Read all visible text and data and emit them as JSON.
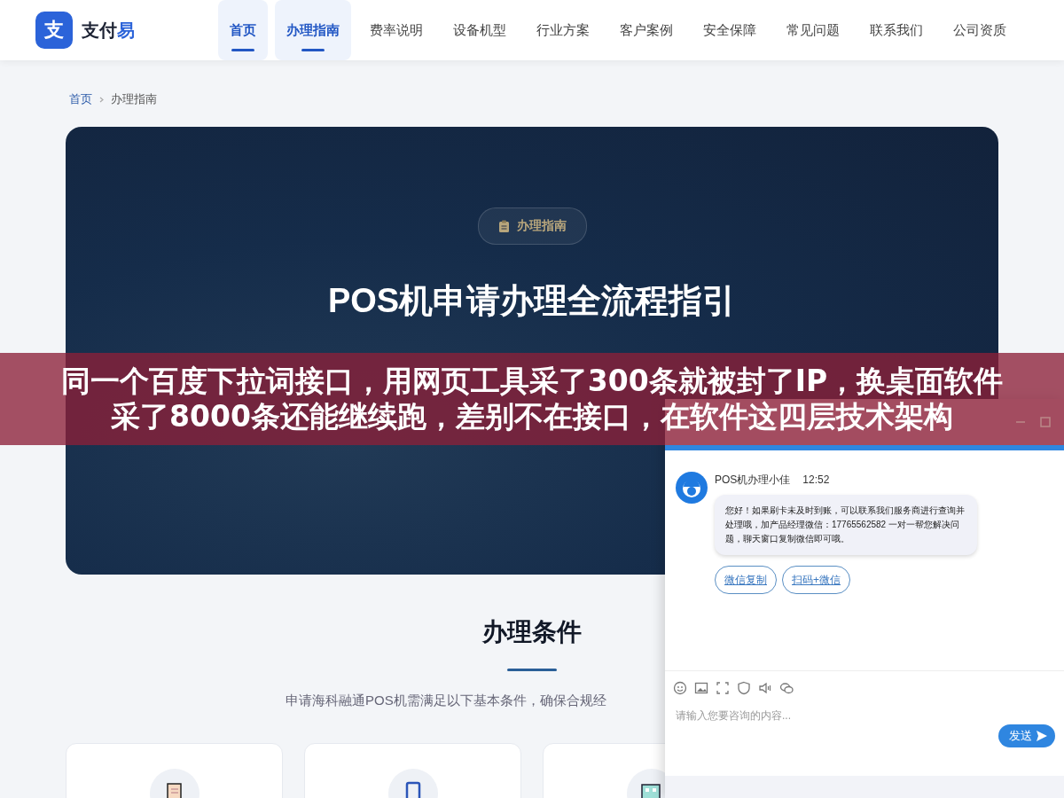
{
  "header": {
    "brand": {
      "mark": "支",
      "name_parts": [
        "支付",
        "易"
      ]
    },
    "nav": [
      {
        "label": "首页",
        "selected": true
      },
      {
        "label": "办理指南",
        "selected": true
      },
      {
        "label": "费率说明",
        "selected": false
      },
      {
        "label": "设备机型",
        "selected": false
      },
      {
        "label": "行业方案",
        "selected": false
      },
      {
        "label": "客户案例",
        "selected": false
      },
      {
        "label": "安全保障",
        "selected": false
      },
      {
        "label": "常见问题",
        "selected": false
      },
      {
        "label": "联系我们",
        "selected": false
      },
      {
        "label": "公司资质",
        "selected": false
      }
    ]
  },
  "breadcrumb": [
    {
      "label": "首页",
      "kind": "link"
    },
    {
      "label": "办理指南",
      "kind": "current"
    }
  ],
  "hero": {
    "badge": "办理指南",
    "title": "POS机申请办理全流程指引"
  },
  "section": {
    "title": "办理条件",
    "subtitle": "申请海科融通POS机需满足以下基本条件，确保合规经",
    "cards": [
      {
        "kind": "document"
      },
      {
        "kind": "phone"
      },
      {
        "kind": "shop"
      }
    ]
  },
  "chat": {
    "agent": "POS机办理小佳",
    "time": "12:52",
    "message": "您好！如果刷卡未及时到账，可以联系我们服务商进行查询并处理哦，加产品经理微信：17765562582 一对一帮您解决问题，聊天窗口复制微信即可哦。",
    "actions": [
      "微信复制",
      "扫码+微信"
    ],
    "placeholder": "请输入您要咨询的内容...",
    "send": "发送"
  },
  "overlay_caption": "同一个百度下拉词接口，用网页工具采了300条就被封了IP，换桌面软件采了8000条还能继续跑，差别不在接口，在软件这四层技术架构"
}
